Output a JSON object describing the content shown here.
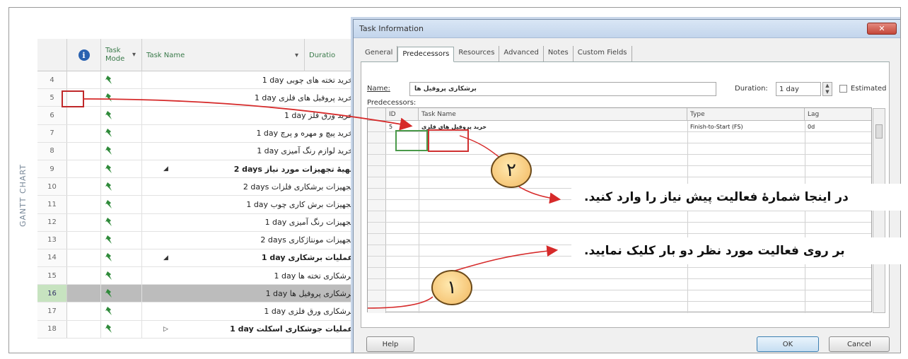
{
  "grid": {
    "side_label": "GANTT CHART",
    "header": {
      "info_symbol": "i",
      "task_mode": "Task Mode",
      "task_name": "Task Name",
      "duration": "Duratio",
      "dropdown_glyph": "▾"
    },
    "rows": [
      {
        "num": "4",
        "name": "1 day خرید تخته های چوبی",
        "bold": false,
        "marker": "",
        "selected": false
      },
      {
        "num": "5",
        "name": "1 day خرید پروفیل های فلزی",
        "bold": false,
        "marker": "",
        "selected": false
      },
      {
        "num": "6",
        "name": "1 day خرید ورق فلز",
        "bold": false,
        "marker": "",
        "selected": false
      },
      {
        "num": "7",
        "name": "1 day خرید پیچ و مهره و پرچ",
        "bold": false,
        "marker": "",
        "selected": false
      },
      {
        "num": "8",
        "name": "1 day خرید لوازم رنگ آمیزی",
        "bold": false,
        "marker": "",
        "selected": false
      },
      {
        "num": "9",
        "name": "2 days تهیهٔ تجهیزات مورد نیاز",
        "bold": true,
        "marker": "◢",
        "selected": false
      },
      {
        "num": "10",
        "name": "2 days تجهیزات برشکاری فلزات",
        "bold": false,
        "marker": "",
        "selected": false
      },
      {
        "num": "11",
        "name": "1 day تجهیزات برش کاری چوب",
        "bold": false,
        "marker": "",
        "selected": false
      },
      {
        "num": "12",
        "name": "1 day تجهیزات رنگ آمیزی",
        "bold": false,
        "marker": "",
        "selected": false
      },
      {
        "num": "13",
        "name": "2 days تجهیزات مونتاژکاری",
        "bold": false,
        "marker": "",
        "selected": false
      },
      {
        "num": "14",
        "name": "1 day عملیات برشکاری",
        "bold": true,
        "marker": "◢",
        "selected": false
      },
      {
        "num": "15",
        "name": "1 day برشکاری تخته ها",
        "bold": false,
        "marker": "",
        "selected": false
      },
      {
        "num": "16",
        "name": "1 day برشکاری پروفیل ها",
        "bold": false,
        "marker": "",
        "selected": true
      },
      {
        "num": "17",
        "name": "1 day برشکاری ورق فلزی",
        "bold": false,
        "marker": "",
        "selected": false
      },
      {
        "num": "18",
        "name": "1 day عملیات جوشکاری اسکلت",
        "bold": true,
        "marker": "▷",
        "selected": false
      }
    ]
  },
  "dialog": {
    "title": "Task Information",
    "close_glyph": "✕",
    "tabs": [
      "General",
      "Predecessors",
      "Resources",
      "Advanced",
      "Notes",
      "Custom Fields"
    ],
    "active_tab": "Predecessors",
    "name_label": "Name:",
    "name_value": "برشکاری پروفیل ها",
    "duration_label": "Duration:",
    "duration_value": "1 day",
    "estimated_label": "Estimated",
    "predecessors_label": "Predecessors:",
    "columns": {
      "id": "ID",
      "task_name": "Task Name",
      "type": "Type",
      "lag": "Lag"
    },
    "pred_row": {
      "id": "5",
      "task_name": "خرید پروفیل های فلزی",
      "type": "Finish-to-Start (FS)",
      "lag": "0d"
    },
    "help_button": "Help",
    "ok_button": "OK",
    "cancel_button": "Cancel"
  },
  "annotations": {
    "step2_text": "در اینجا شمارهٔ فعالیت پیش نیاز را وارد کنید.",
    "step1_text": "بر روی فعالیت مورد نظر دو بار کلیک نمایید.",
    "badge2": "۲",
    "badge1": "۱",
    "arrow_color": "#d62a2a"
  }
}
